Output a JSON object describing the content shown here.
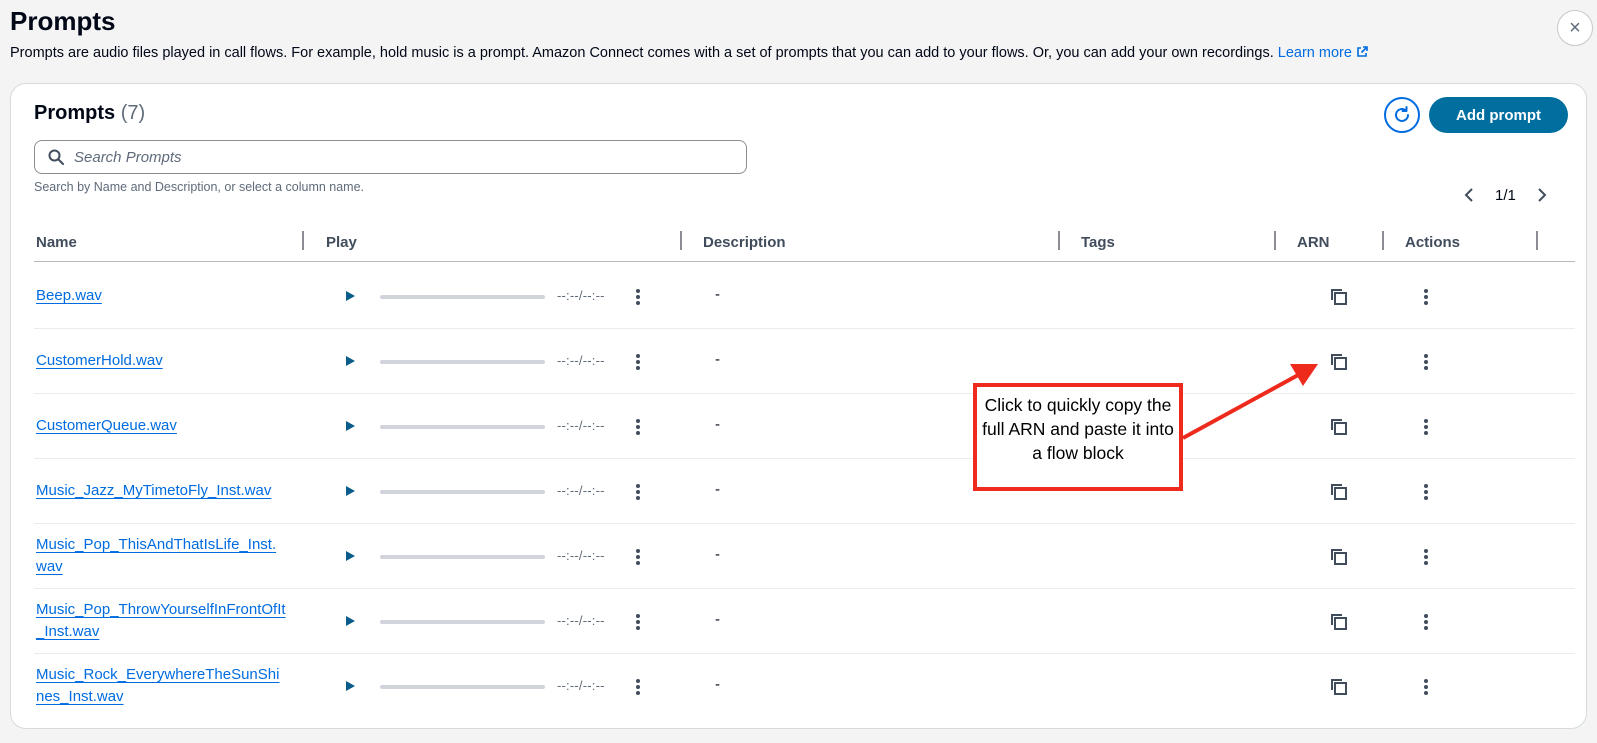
{
  "header": {
    "title": "Prompts",
    "description": "Prompts are audio files played in call flows. For example, hold music is a prompt. Amazon Connect comes with a set of prompts that you can add to your flows. Or, you can add your own recordings.",
    "learn_more": "Learn more",
    "close_label": "×"
  },
  "panel": {
    "title": "Prompts",
    "count": "(7)",
    "add_button": "Add prompt",
    "search_placeholder": "Search Prompts",
    "search_hint": "Search by Name and Description, or select a column name.",
    "page_indicator": "1/1"
  },
  "columns": [
    "Name",
    "Play",
    "Description",
    "Tags",
    "ARN",
    "Actions"
  ],
  "rows": [
    {
      "name": "Beep.wav",
      "time": "--:--/--:--",
      "description": "-",
      "tags": ""
    },
    {
      "name": "CustomerHold.wav",
      "time": "--:--/--:--",
      "description": "-",
      "tags": ""
    },
    {
      "name": "CustomerQueue.wav",
      "time": "--:--/--:--",
      "description": "-",
      "tags": ""
    },
    {
      "name": "Music_Jazz_MyTimetoFly_Inst.wav",
      "time": "--:--/--:--",
      "description": "-",
      "tags": ""
    },
    {
      "name": "Music_Pop_ThisAndThatIsLife_Inst.wav",
      "time": "--:--/--:--",
      "description": "-",
      "tags": ""
    },
    {
      "name": "Music_Pop_ThrowYourselfInFrontOfIt_Inst.wav",
      "time": "--:--/--:--",
      "description": "-",
      "tags": ""
    },
    {
      "name": "Music_Rock_EverywhereTheSunShines_Inst.wav",
      "time": "--:--/--:--",
      "description": "-",
      "tags": ""
    }
  ],
  "callout": {
    "text": "Click to quickly copy the full ARN and paste it into a flow block"
  },
  "colors": {
    "link": "#006ce0",
    "primary_button": "#006f9f",
    "callout_border": "#ee2a1d"
  }
}
